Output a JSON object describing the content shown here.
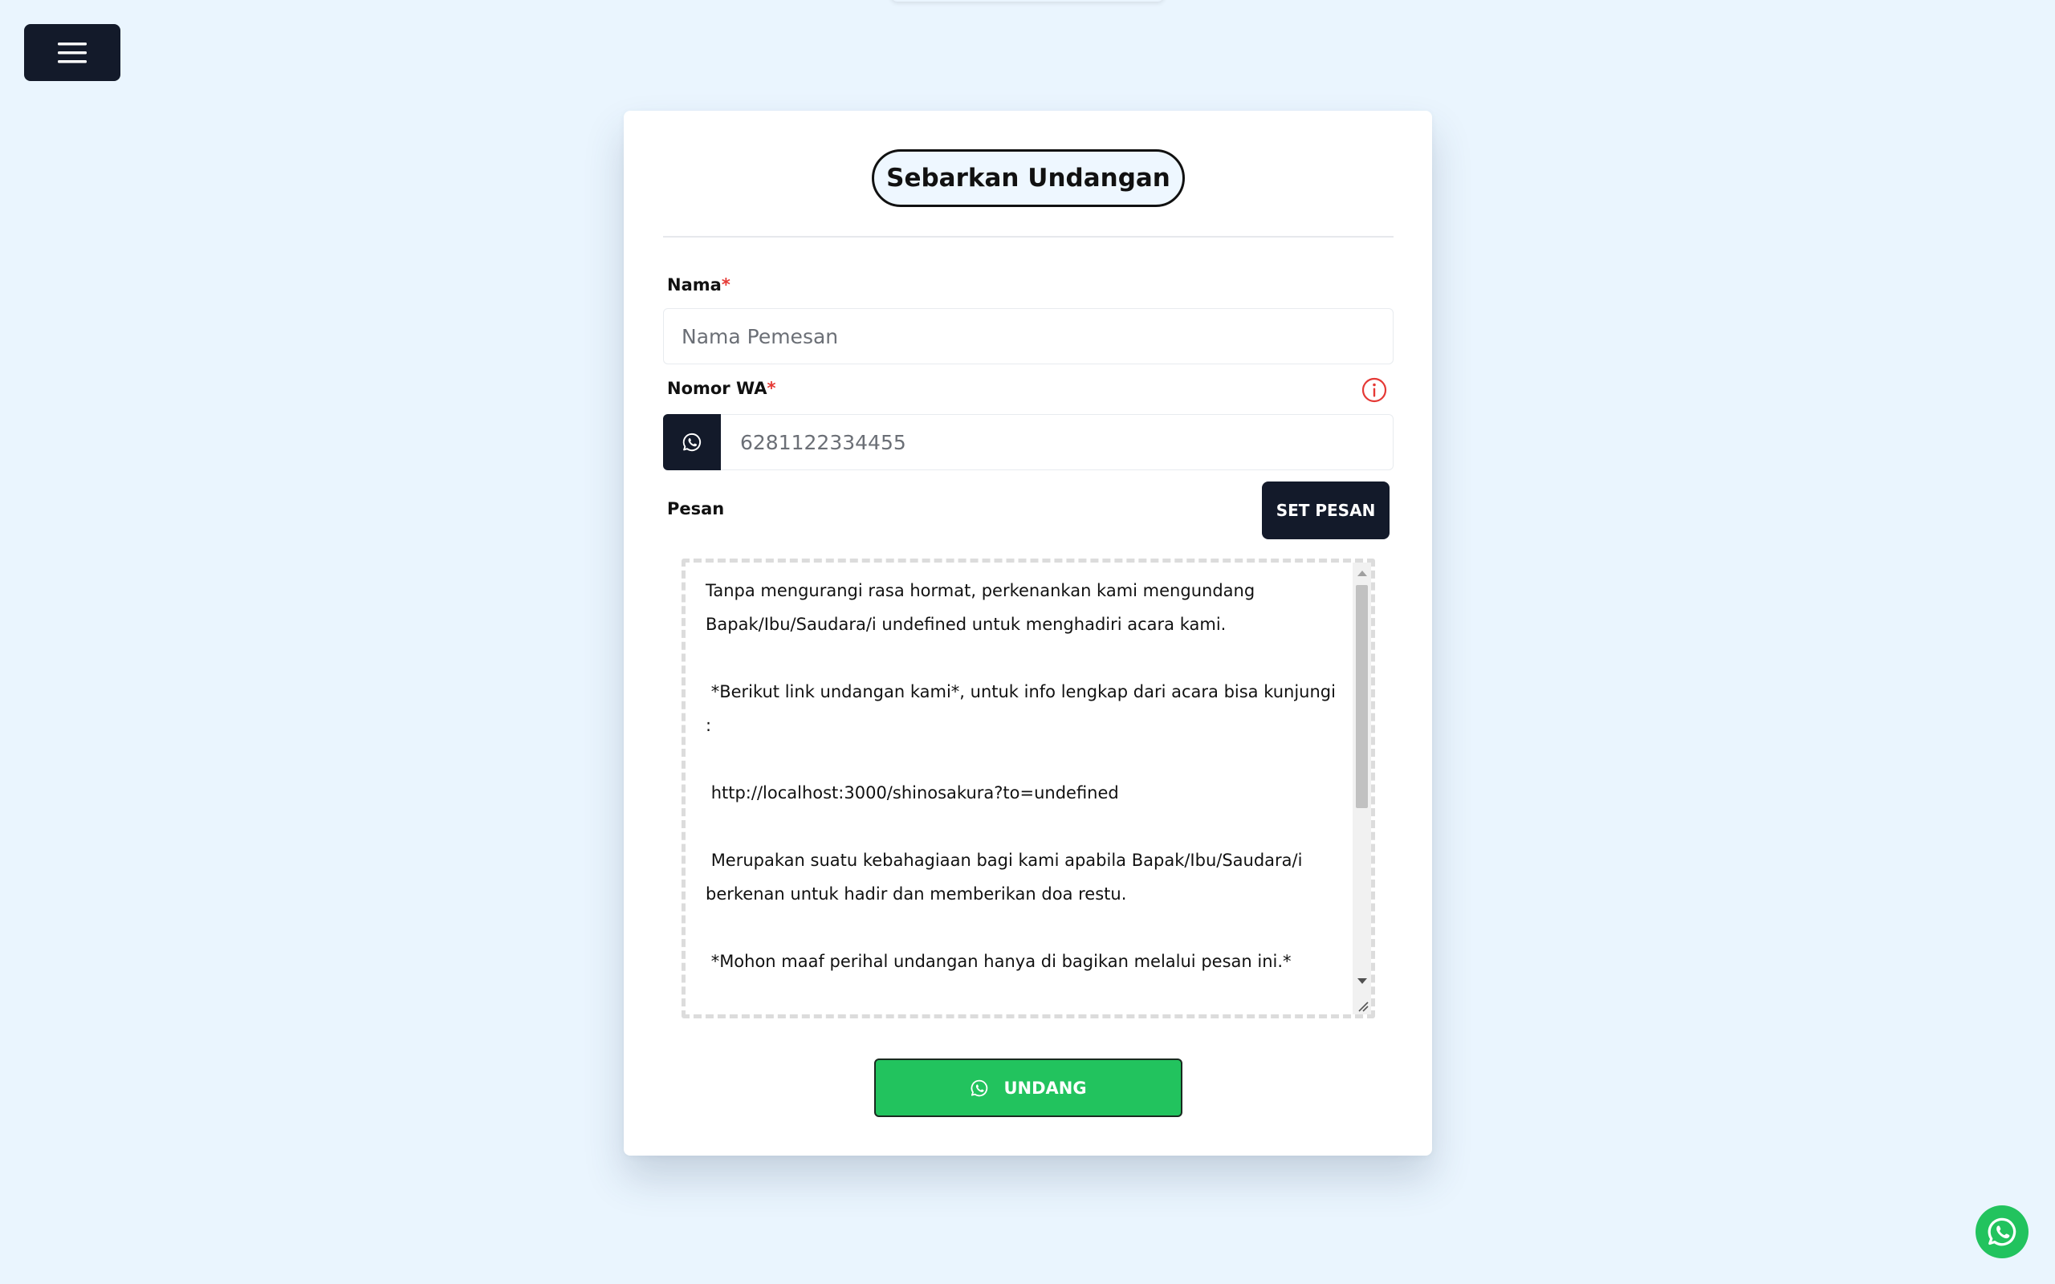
{
  "header": {
    "menu_icon": "hamburger-menu-icon"
  },
  "card": {
    "title": "Sebarkan Undangan",
    "name_field": {
      "label": "Nama",
      "required_mark": "*",
      "placeholder": "Nama Pemesan",
      "value": ""
    },
    "wa_field": {
      "label": "Nomor WA",
      "required_mark": "*",
      "placeholder": "6281122334455",
      "value": "",
      "addon_icon": "whatsapp-icon",
      "info_icon": "info-icon"
    },
    "message": {
      "label": "Pesan",
      "set_button": "SET PESAN",
      "text": "Tanpa mengurangi rasa hormat, perkenankan kami mengundang Bapak/Ibu/Saudara/i undefined untuk menghadiri acara kami.\n\n *Berikut link undangan kami*, untuk info lengkap dari acara bisa kunjungi :\n\n http://localhost:3000/shinosakura?to=undefined\n\n Merupakan suatu kebahagiaan bagi kami apabila Bapak/Ibu/Saudara/i berkenan untuk hadir dan memberikan doa restu.\n\n *Mohon maaf perihal undangan hanya di bagikan melalui pesan ini.*"
    },
    "submit_button": "UNDANG"
  },
  "floating_button": {
    "icon": "whatsapp-icon"
  },
  "colors": {
    "page_bg": "#eaf5fe",
    "dark": "#131a2a",
    "green": "#22c35e",
    "required": "#e53935"
  }
}
